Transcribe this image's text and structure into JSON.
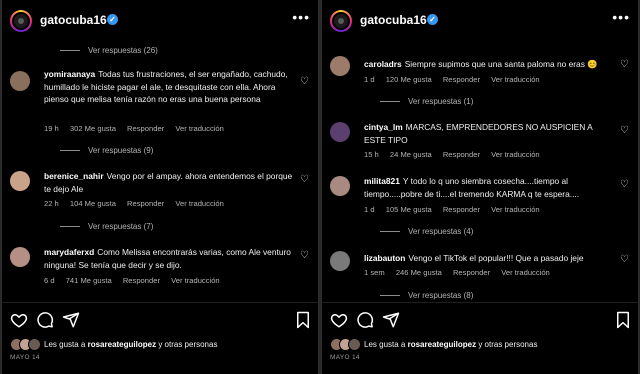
{
  "left": {
    "username": "gatocuba16",
    "top_view_replies": "Ver respuestas (26)",
    "comments": [
      {
        "user": "yomiraanaya",
        "text": "Todas tus frustraciones, el ser engañado, cachudo, humillado le hiciste pagar el ale, te desquitaste con ella. Ahora pienso que melisa tenía razón no eras una buena persona",
        "time": "19 h",
        "likes": "302 Me gusta",
        "reply": "Responder",
        "translate": "Ver traducción",
        "view_replies": "Ver respuestas (9)",
        "avatar_color": "#8a6f5c"
      },
      {
        "user": "berenice_nahir",
        "text": "Vengo por el ampay. ahora entendemos el porque te dejo Ale",
        "time": "22 h",
        "likes": "104 Me gusta",
        "reply": "Responder",
        "translate": "Ver traducción",
        "view_replies": "Ver respuestas (7)",
        "avatar_color": "#c9a28a"
      },
      {
        "user": "marydaferxd",
        "text": "Como Melissa encontrarás varias, como Ale venturo ninguna! Se tenía que decir y se dijo.",
        "time": "6 d",
        "likes": "741 Me gusta",
        "reply": "Responder",
        "translate": "Ver traducción",
        "avatar_color": "#b58f86"
      }
    ],
    "likes_by": "rosareateguilopez",
    "likes_prefix": "Les gusta a",
    "likes_suffix": "y otras personas",
    "date": "MAYO 14"
  },
  "right": {
    "username": "gatocuba16",
    "comments": [
      {
        "user": "caroladrs",
        "text": "Siempre supimos que una santa paloma no eras 😊",
        "time": "1 d",
        "likes": "120 Me gusta",
        "reply": "Responder",
        "translate": "Ver traducción",
        "view_replies": "Ver respuestas (1)",
        "avatar_color": "#9c7b6b"
      },
      {
        "user": "cintya_lm",
        "text": "MARCAS, EMPRENDEDORES NO AUSPICIEN A ESTE TIPO",
        "time": "15 h",
        "likes": "24 Me gusta",
        "reply": "Responder",
        "translate": "Ver traducción",
        "avatar_color": "#5b3f6e"
      },
      {
        "user": "milita821",
        "text": "Y todo lo q uno siembra cosecha....tiempo al tiempo.....pobre de ti....el tremendo KARMA q te espera....",
        "time": "1 d",
        "likes": "105 Me gusta",
        "reply": "Responder",
        "translate": "Ver traducción",
        "view_replies": "Ver respuestas (4)",
        "avatar_color": "#a88a80"
      },
      {
        "user": "lizabauton",
        "text": "Vengo el TikTok el popular!!! Que a pasado jeje",
        "time": "1 sem",
        "likes": "246 Me gusta",
        "reply": "Responder",
        "translate": "Ver traducción",
        "view_replies": "Ver respuestas (8)",
        "avatar_color": "#7a7a7a"
      }
    ],
    "likes_by": "rosareateguilopez",
    "likes_prefix": "Les gusta a",
    "likes_suffix": "y otras personas",
    "date": "MAYO 14"
  },
  "icons": {
    "like": "heart-icon",
    "comment": "comment-icon",
    "share": "share-icon",
    "save": "bookmark-icon",
    "verified": "verified-badge-icon",
    "more": "more-options-icon"
  },
  "colors": {
    "background": "#000000",
    "verified": "#3897f0",
    "muted_text": "#b4b4b4"
  }
}
